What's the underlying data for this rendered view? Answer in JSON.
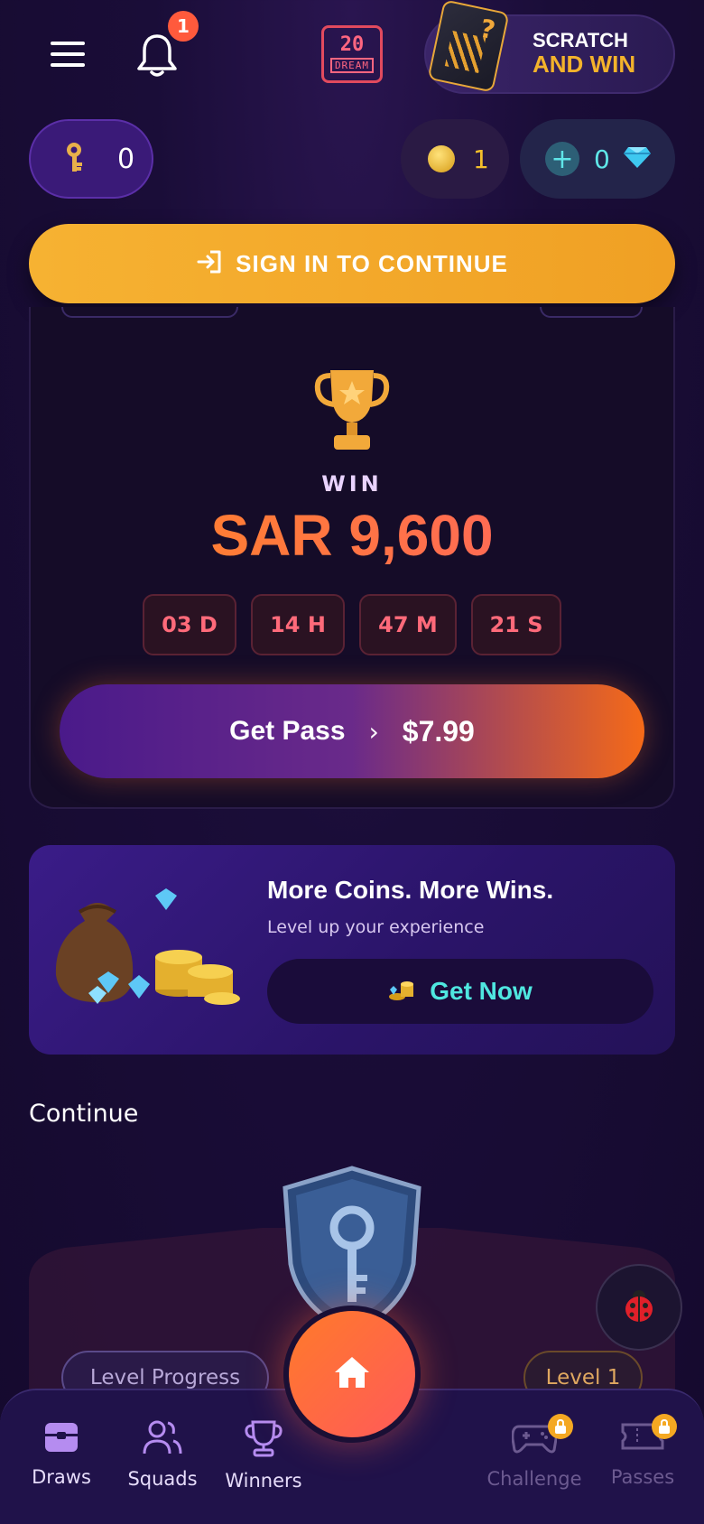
{
  "header": {
    "notification_count": "1",
    "logo_number": "20",
    "logo_word": "DREAM",
    "scratch_line1": "SCRATCH",
    "scratch_line2": "AND WIN"
  },
  "balances": {
    "keys": "0",
    "coins": "1",
    "gems": "0"
  },
  "signin": {
    "label": "SIGN IN TO CONTINUE"
  },
  "draw": {
    "win_label": "WIN",
    "prize": "SAR 9,600",
    "countdown": {
      "days": "03 D",
      "hours": "14 H",
      "minutes": "47 M",
      "seconds": "21 S"
    },
    "get_pass_label": "Get Pass",
    "get_pass_chevron": "›",
    "price": "$7.99"
  },
  "promo": {
    "title": "More Coins. More Wins.",
    "subtitle": "Level up your experience",
    "button_label": "Get Now"
  },
  "continue_label": "Continue",
  "level": {
    "progress_label": "Level Progress",
    "level_label": "Level 1"
  },
  "bottom_nav": {
    "items": [
      {
        "label": "Draws",
        "icon": "chest-icon",
        "locked": false
      },
      {
        "label": "Squads",
        "icon": "users-icon",
        "locked": false
      },
      {
        "label": "Winners",
        "icon": "trophy-icon",
        "locked": false
      },
      {
        "label": "Challenge",
        "icon": "gamepad-icon",
        "locked": true
      },
      {
        "label": "Passes",
        "icon": "ticket-icon",
        "locked": true
      }
    ]
  },
  "colors": {
    "accent_orange": "#ff7a2a",
    "signin_yellow": "#f6b232",
    "teal": "#4fe7e0",
    "bg": "#1a0d38"
  }
}
